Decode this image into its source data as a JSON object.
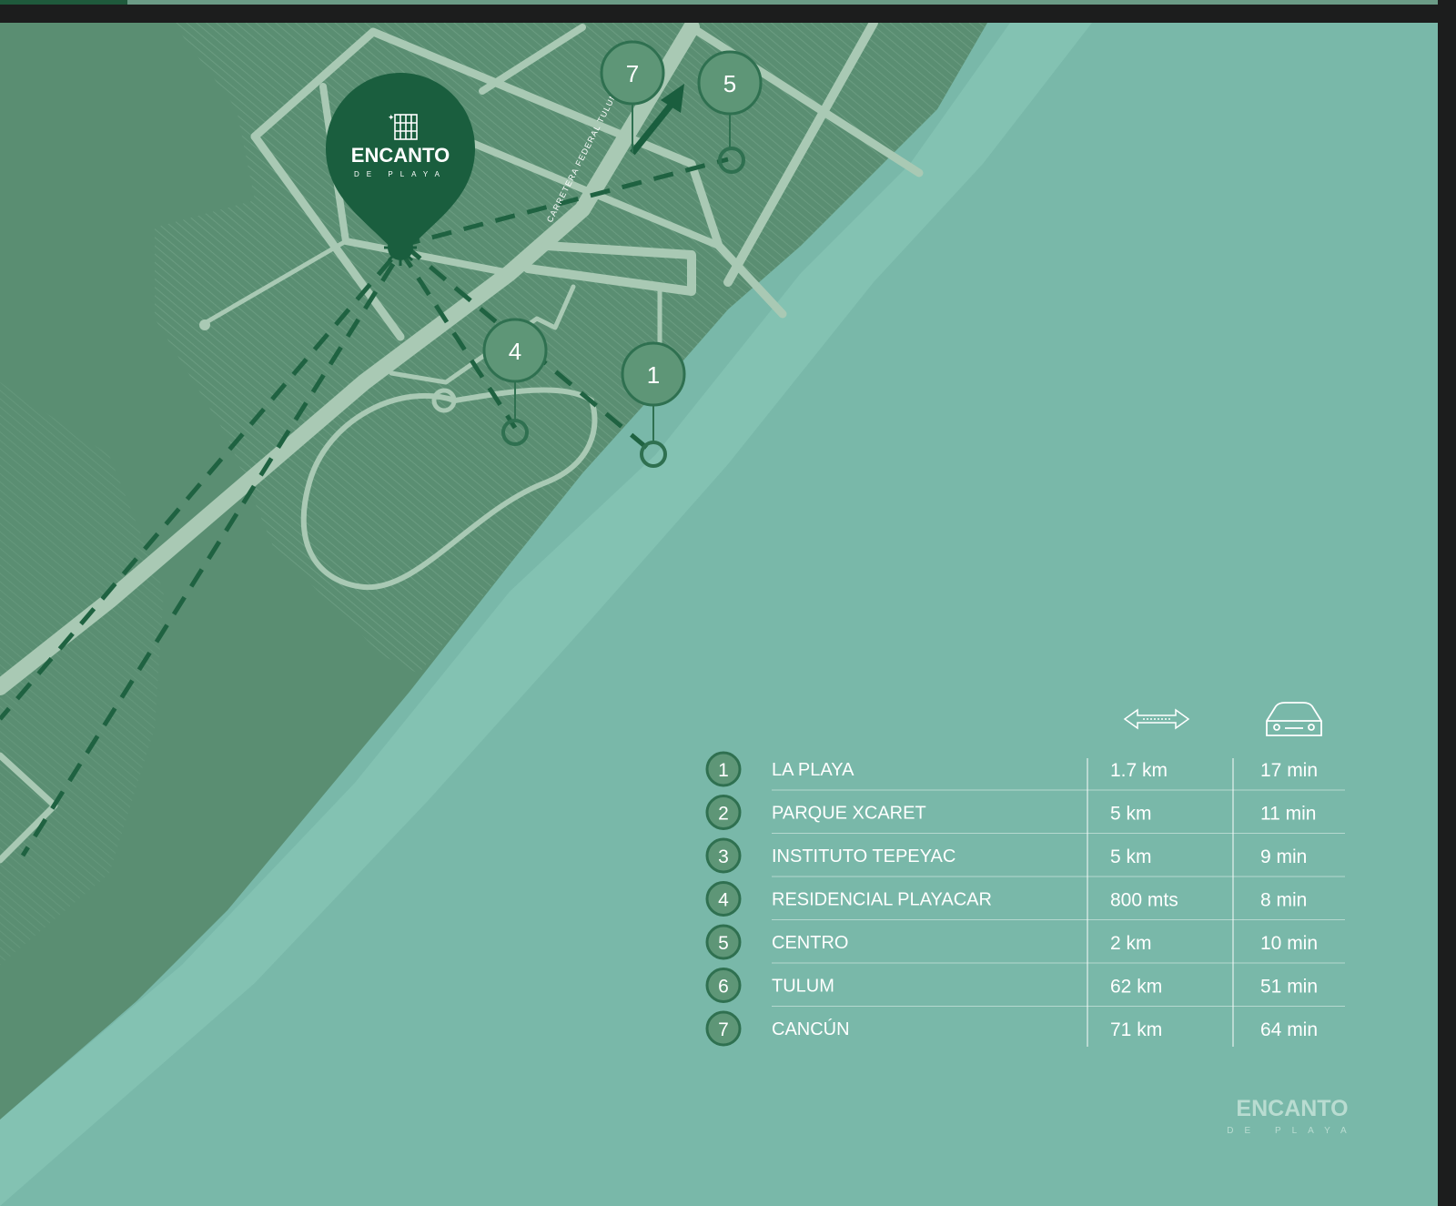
{
  "brand": {
    "name": "ENCANTO",
    "tagline": "DE PLAYA"
  },
  "road_label": "CARRETERA FEDERAL TULUM",
  "map_markers": [
    {
      "number": "7"
    },
    {
      "number": "5"
    },
    {
      "number": "4"
    },
    {
      "number": "1"
    }
  ],
  "legend": {
    "distance_icon": "ruler-arrow-icon",
    "time_icon": "car-icon",
    "rows": [
      {
        "number": "1",
        "name": "LA PLAYA",
        "distance": "1.7 km",
        "time": "17 min"
      },
      {
        "number": "2",
        "name": "PARQUE XCARET",
        "distance": "5 km",
        "time": "11 min"
      },
      {
        "number": "3",
        "name": "INSTITUTO TEPEYAC",
        "distance": "5 km",
        "time": "9 min"
      },
      {
        "number": "4",
        "name": "RESIDENCIAL PLAYACAR",
        "distance": "800 mts",
        "time": "8 min"
      },
      {
        "number": "5",
        "name": "CENTRO",
        "distance": "2 km",
        "time": "10 min"
      },
      {
        "number": "6",
        "name": "TULUM",
        "distance": "62 km",
        "time": "51 min"
      },
      {
        "number": "7",
        "name": "CANCÚN",
        "distance": "71 km",
        "time": "64 min"
      }
    ]
  },
  "colors": {
    "sea": "#79b8a9",
    "shore": "#8ccab9",
    "land": "#5a8e72",
    "road": "#a9c9b4",
    "marker": "#2f7050",
    "pin": "#1a5e3e"
  }
}
